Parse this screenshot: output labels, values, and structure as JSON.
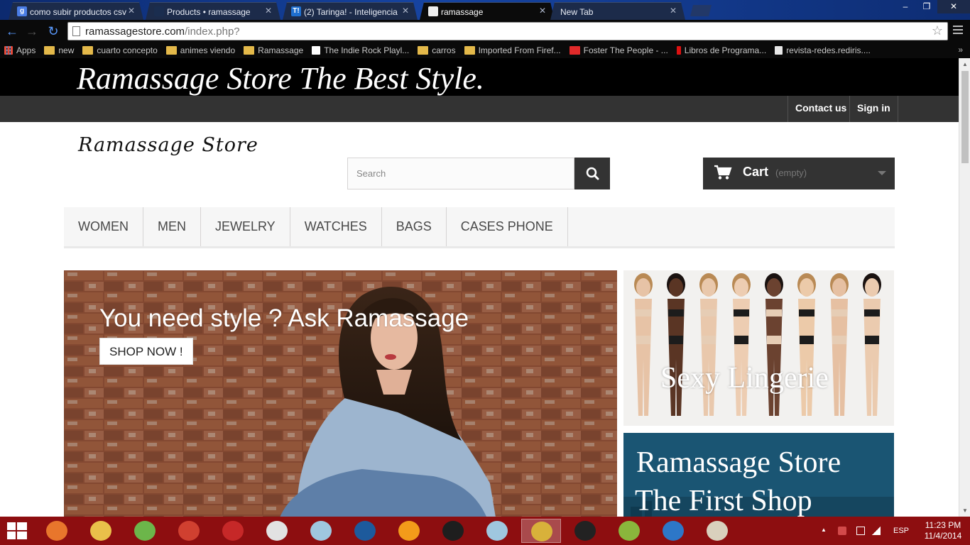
{
  "browser": {
    "tabs": [
      {
        "label": "como subir productos csv",
        "favicon": "google-icon",
        "favicon_color": "#4a7de6",
        "favicon_text": "g",
        "active": false
      },
      {
        "label": "Products • ramassage",
        "favicon": "prestashop-icon",
        "favicon_color": "#1a2d4f",
        "favicon_text": "",
        "active": false
      },
      {
        "label": "(2) Taringa! - Inteligencia",
        "favicon": "taringa-icon",
        "favicon_color": "#1e6fd0",
        "favicon_text": "T!",
        "active": false
      },
      {
        "label": "ramassage",
        "favicon": "ramassage-icon",
        "favicon_color": "#eeeeee",
        "favicon_text": "",
        "active": true
      },
      {
        "label": "New Tab",
        "favicon": "",
        "favicon_color": "",
        "favicon_text": "",
        "active": false
      }
    ],
    "url_host": "ramassagestore.com",
    "url_path": "/index.php?",
    "bookmarks": [
      {
        "label": "Apps",
        "icon": "apps-icon"
      },
      {
        "label": "new",
        "icon": "folder-icon"
      },
      {
        "label": "cuarto concepto",
        "icon": "folder-icon"
      },
      {
        "label": "animes viendo",
        "icon": "folder-icon"
      },
      {
        "label": "Ramassage",
        "icon": "folder-icon"
      },
      {
        "label": "The Indie Rock Playl...",
        "icon": "page-icon"
      },
      {
        "label": "carros",
        "icon": "folder-icon"
      },
      {
        "label": "Imported From Firef...",
        "icon": "folder-icon"
      },
      {
        "label": "Foster The People - ...",
        "icon": "youtube-icon"
      },
      {
        "label": "Libros de Programa...",
        "icon": "bookmark-red-icon"
      },
      {
        "label": "revista-redes.rediris....",
        "icon": "document-icon"
      }
    ]
  },
  "site": {
    "banner_title": "Ramassage Store The Best Style.",
    "contact_label": "Contact us",
    "signin_label": "Sign in",
    "logo_text": "Ramassage Store",
    "search_placeholder": "Search",
    "cart_label": "Cart",
    "cart_status": "(empty)",
    "menu": [
      "WOMEN",
      "MEN",
      "JEWELRY",
      "WATCHES",
      "BAGS",
      "CASES PHONE"
    ],
    "slider_caption": "You need style ? Ask Ramassage",
    "slider_button": "SHOP NOW !",
    "promo1_caption": "Sexy Lingerie",
    "promo2_line1": "Ramassage Store",
    "promo2_line2": "The First Shop"
  },
  "taskbar": {
    "apps": [
      "firefox-icon",
      "file-explorer-icon",
      "notepad-icon",
      "ccleaner-icon",
      "filezilla-icon",
      "snipping-icon",
      "app-icon",
      "photoshop-icon",
      "bitcoin-icon",
      "spotify-icon",
      "app-icon",
      "chrome-icon",
      "unity-icon",
      "android-icon",
      "virtualbox-icon",
      "paint-icon"
    ],
    "active_app": "chrome-icon",
    "language": "ESP",
    "time": "11:23 PM",
    "date": "11/4/2014"
  },
  "colors": {
    "banner_bg": "#000000",
    "userbar_bg": "#333333",
    "taskbar_bg": "#8d0e10",
    "promo2_bg": "#1b5470"
  }
}
